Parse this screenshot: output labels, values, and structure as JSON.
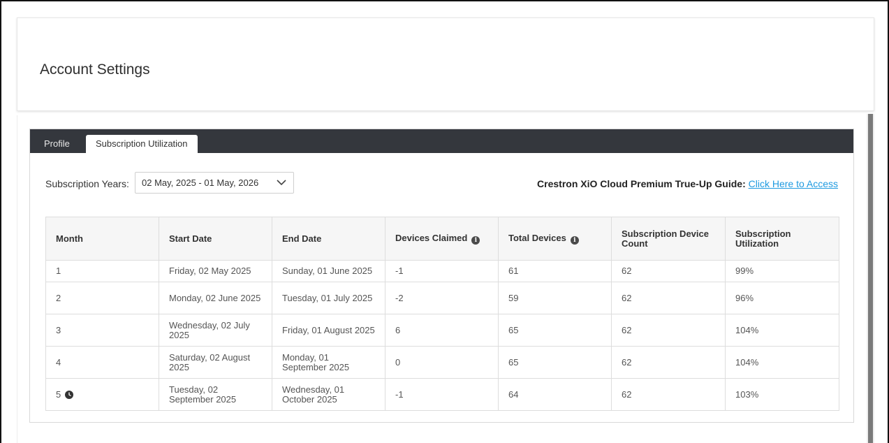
{
  "page": {
    "title": "Account Settings"
  },
  "tabs": [
    {
      "label": "Profile"
    },
    {
      "label": "Subscription Utilization"
    }
  ],
  "filter": {
    "label": "Subscription Years:",
    "selected": "02 May, 2025 - 01 May, 2026"
  },
  "guide": {
    "label": "Crestron XiO Cloud Premium True-Up Guide:",
    "link_text": "Click Here to Access"
  },
  "table": {
    "headers": [
      "Month",
      "Start Date",
      "End Date",
      "Devices Claimed",
      "Total Devices",
      "Subscription Device Count",
      "Subscription Utilization"
    ],
    "rows": [
      {
        "month": "1",
        "start": "Friday, 02 May 2025",
        "end": "Sunday, 01 June 2025",
        "claimed": "-1",
        "total": "61",
        "count": "62",
        "util": "99%"
      },
      {
        "month": "2",
        "start": "Monday, 02 June 2025",
        "end": "Tuesday, 01 July 2025",
        "claimed": "-2",
        "total": "59",
        "count": "62",
        "util": "96%"
      },
      {
        "month": "3",
        "start": "Wednesday, 02 July 2025",
        "end": "Friday, 01 August 2025",
        "claimed": "6",
        "total": "65",
        "count": "62",
        "util": "104%"
      },
      {
        "month": "4",
        "start": "Saturday, 02 August 2025",
        "end": "Monday, 01 September 2025",
        "claimed": "0",
        "total": "65",
        "count": "62",
        "util": "104%"
      },
      {
        "month": "5",
        "start": "Tuesday, 02 September 2025",
        "end": "Wednesday, 01 October 2025",
        "claimed": "-1",
        "total": "64",
        "count": "62",
        "util": "103%"
      }
    ]
  },
  "icons": {
    "info": "info-icon",
    "clock": "clock-icon",
    "dropdown": "chevron-down-icon"
  },
  "colors": {
    "tabbar": "#34373d",
    "link": "#1e9ae0"
  }
}
